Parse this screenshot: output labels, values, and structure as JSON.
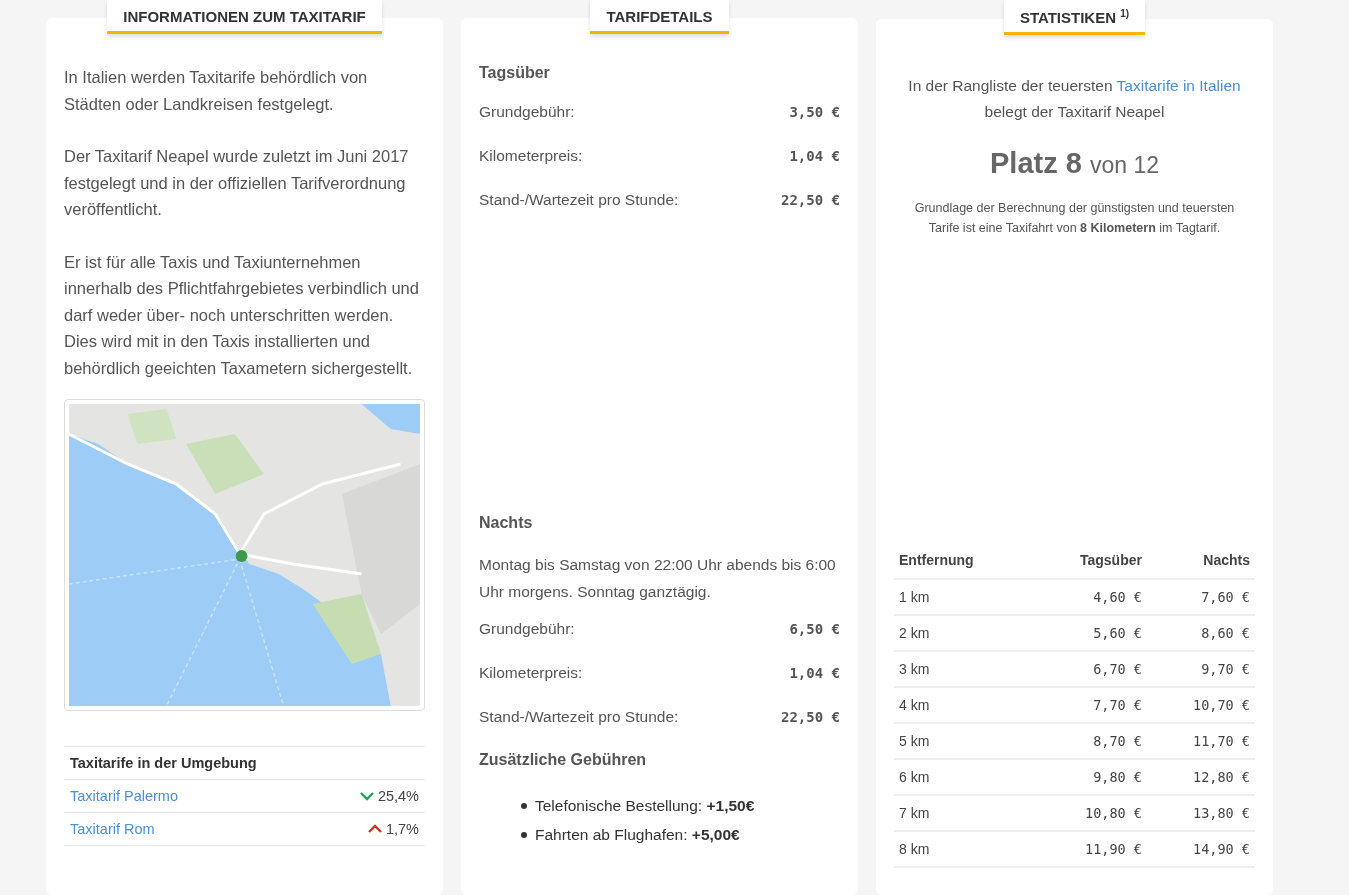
{
  "info_card": {
    "title": "INFORMATIONEN ZUM TAXITARIF",
    "paragraphs": [
      "In Italien werden Taxitarife behördlich von Städten oder Landkreisen festgelegt.",
      "Der Taxitarif Neapel wurde zuletzt im Juni 2017 festgelegt und in der offiziellen Tarifverordnung veröffentlicht.",
      "Er ist für alle Taxis und Taxiunternehmen innerhalb des Pflichtfahrgebietes verbindlich und darf weder über- noch unterschritten werden. Dies wird mit in den Taxis installierten und behördlich geeichten Taxametern sichergestellt."
    ],
    "nearby": {
      "heading": "Taxitarife in der Umgebung",
      "rows": [
        {
          "label": "Taxitarif Palermo",
          "increase": false,
          "change": "25,4%"
        },
        {
          "label": "Taxitarif Rom",
          "increase": true,
          "change": "1,7%"
        }
      ]
    }
  },
  "tariff_card": {
    "title": "TARIFDETAILS",
    "sections": [
      {
        "heading": "Tagsüber",
        "rows": [
          {
            "label": "Grundgebühr:",
            "value": "3,50 €"
          },
          {
            "label": "Kilometerpreis:",
            "value": "1,04 €"
          },
          {
            "label": "Stand-/Wartezeit pro Stunde:",
            "value": "22,50 €"
          }
        ]
      },
      {
        "heading": "Nachts",
        "note": "Montag bis Samstag von 22:00 Uhr abends bis 6:00 Uhr morgens. Sonntag ganztägig.",
        "rows": [
          {
            "label": "Grundgebühr:",
            "value": "6,50 €"
          },
          {
            "label": "Kilometerpreis:",
            "value": "1,04 €"
          },
          {
            "label": "Stand-/Wartezeit pro Stunde:",
            "value": "22,50 €"
          }
        ]
      }
    ],
    "extra": {
      "heading": "Zusätzliche Gebühren",
      "items": [
        "Telefonische Bestellung: **+1,50€**",
        "Fahrten ab Flughafen: **+5,00€**"
      ]
    }
  },
  "stats_card": {
    "title": "STATISTIKEN $^{1)}$",
    "ranking": {
      "before": "In der Rangliste der teuersten",
      "link": "Taxitarife in Italien",
      "after": "belegt der Taxitarif Neapel"
    },
    "rank": {
      "place": "Platz 8",
      "total": "von 12"
    },
    "note": "Grundlage der Berechnung der günstigsten und teuersten Tarife ist eine Taxifahrt von **8 Kilometern** im Tagtarif.",
    "table": {
      "columns": [
        "Entfernung",
        "Tagsüber",
        "Nachts"
      ],
      "rows": [
        [
          "1 km",
          "4,60 €",
          "7,60 €"
        ],
        [
          "2 km",
          "5,60 €",
          "8,60 €"
        ],
        [
          "3 km",
          "6,70 €",
          "9,70 €"
        ],
        [
          "4 km",
          "7,70 €",
          "10,70 €"
        ],
        [
          "5 km",
          "8,70 €",
          "11,70 €"
        ],
        [
          "6 km",
          "9,80 €",
          "12,80 €"
        ],
        [
          "7 km",
          "10,80 €",
          "13,80 €"
        ],
        [
          "8 km",
          "11,90 €",
          "14,90 €"
        ]
      ]
    }
  }
}
